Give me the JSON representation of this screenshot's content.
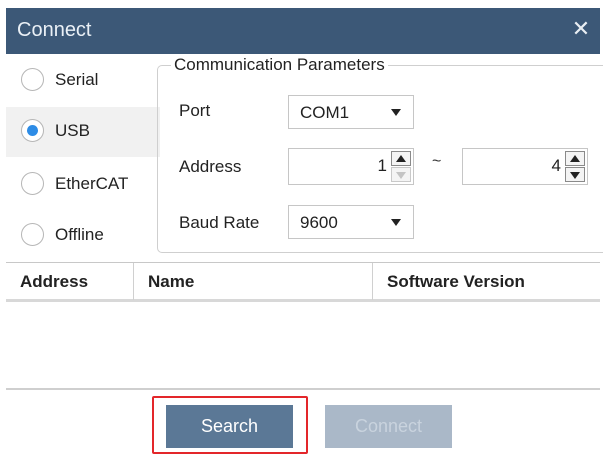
{
  "dialog": {
    "title": "Connect",
    "close_symbol": "✕"
  },
  "connection_types": [
    {
      "label": "Serial",
      "selected": false
    },
    {
      "label": "USB",
      "selected": true
    },
    {
      "label": "EtherCAT",
      "selected": false
    },
    {
      "label": "Offline",
      "selected": false
    }
  ],
  "comm_params": {
    "title": "Communication Parameters",
    "port": {
      "label": "Port",
      "value": "COM1"
    },
    "address": {
      "label": "Address",
      "from": "1",
      "to": "4",
      "separator": "~"
    },
    "baud_rate": {
      "label": "Baud Rate",
      "value": "9600"
    }
  },
  "table": {
    "columns": [
      "Address",
      "Name",
      "Software Version"
    ],
    "rows": []
  },
  "buttons": {
    "search": "Search",
    "connect": "Connect"
  },
  "colors": {
    "titlebar": "#3c5877",
    "radio_checked": "#2d8ce6",
    "search_button": "#5b7896",
    "connect_button_disabled": "#aab8c8",
    "highlight_box": "#e3262a"
  }
}
